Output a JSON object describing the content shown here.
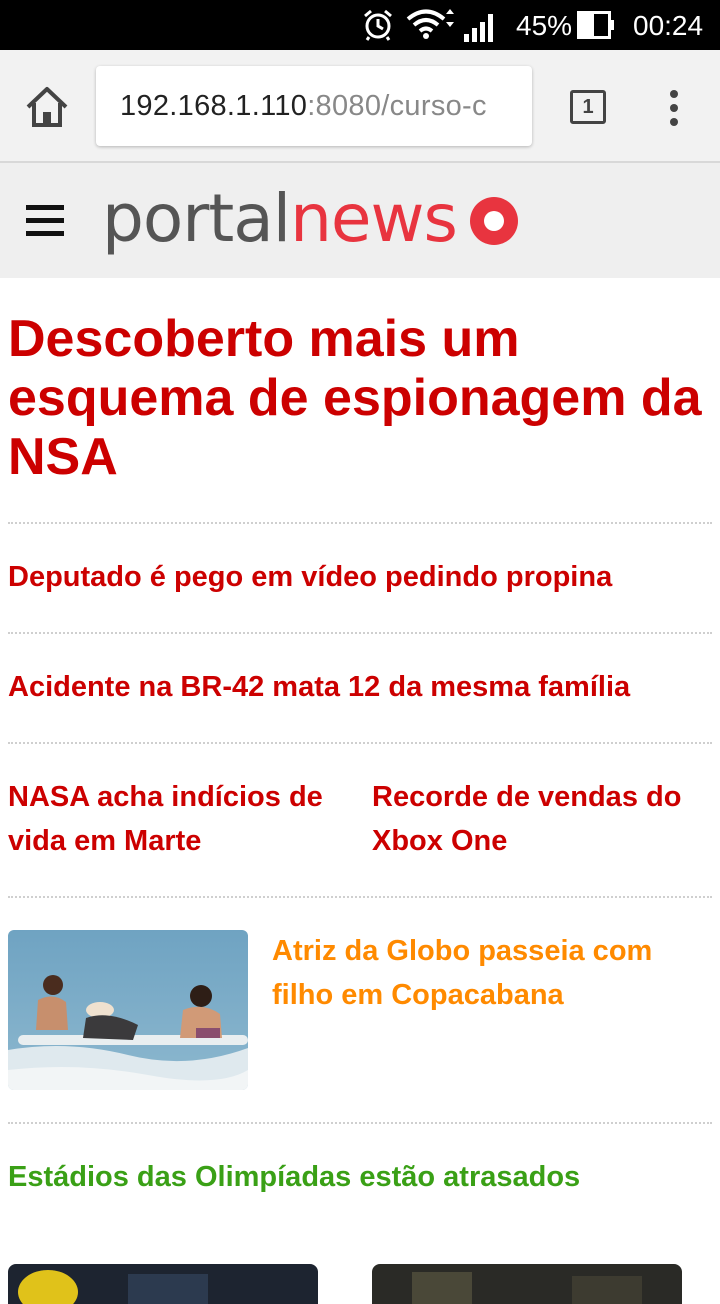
{
  "status_bar": {
    "battery_percent": "45%",
    "time": "00:24",
    "icons": [
      "alarm-icon",
      "wifi-icon",
      "signal-icon",
      "battery-icon"
    ]
  },
  "browser": {
    "url_host": "192.168.1.110",
    "url_rest": ":8080/curso-c",
    "tab_count": "1",
    "icons": [
      "home-icon",
      "tabs-icon",
      "overflow-menu-icon"
    ]
  },
  "site": {
    "logo_part1": "portal",
    "logo_part2": "news",
    "colors": {
      "brand_red": "#e8343f",
      "headline_red": "#cc0000",
      "orange": "#ff8a00",
      "green": "#3aa016"
    }
  },
  "articles": {
    "lead": "Descoberto mais um esquema de espionagem da NSA",
    "item1": "Deputado é pego em vídeo pedindo propina",
    "item2": "Acidente na BR-42 mata 12 da mesma família",
    "item3a": "NASA acha indícios de vida em Marte",
    "item3b": "Recorde de vendas do Xbox One",
    "item4": "Atriz da Globo passeia com filho em Copacabana",
    "item5": "Estádios das Olimpíadas estão atrasados"
  }
}
